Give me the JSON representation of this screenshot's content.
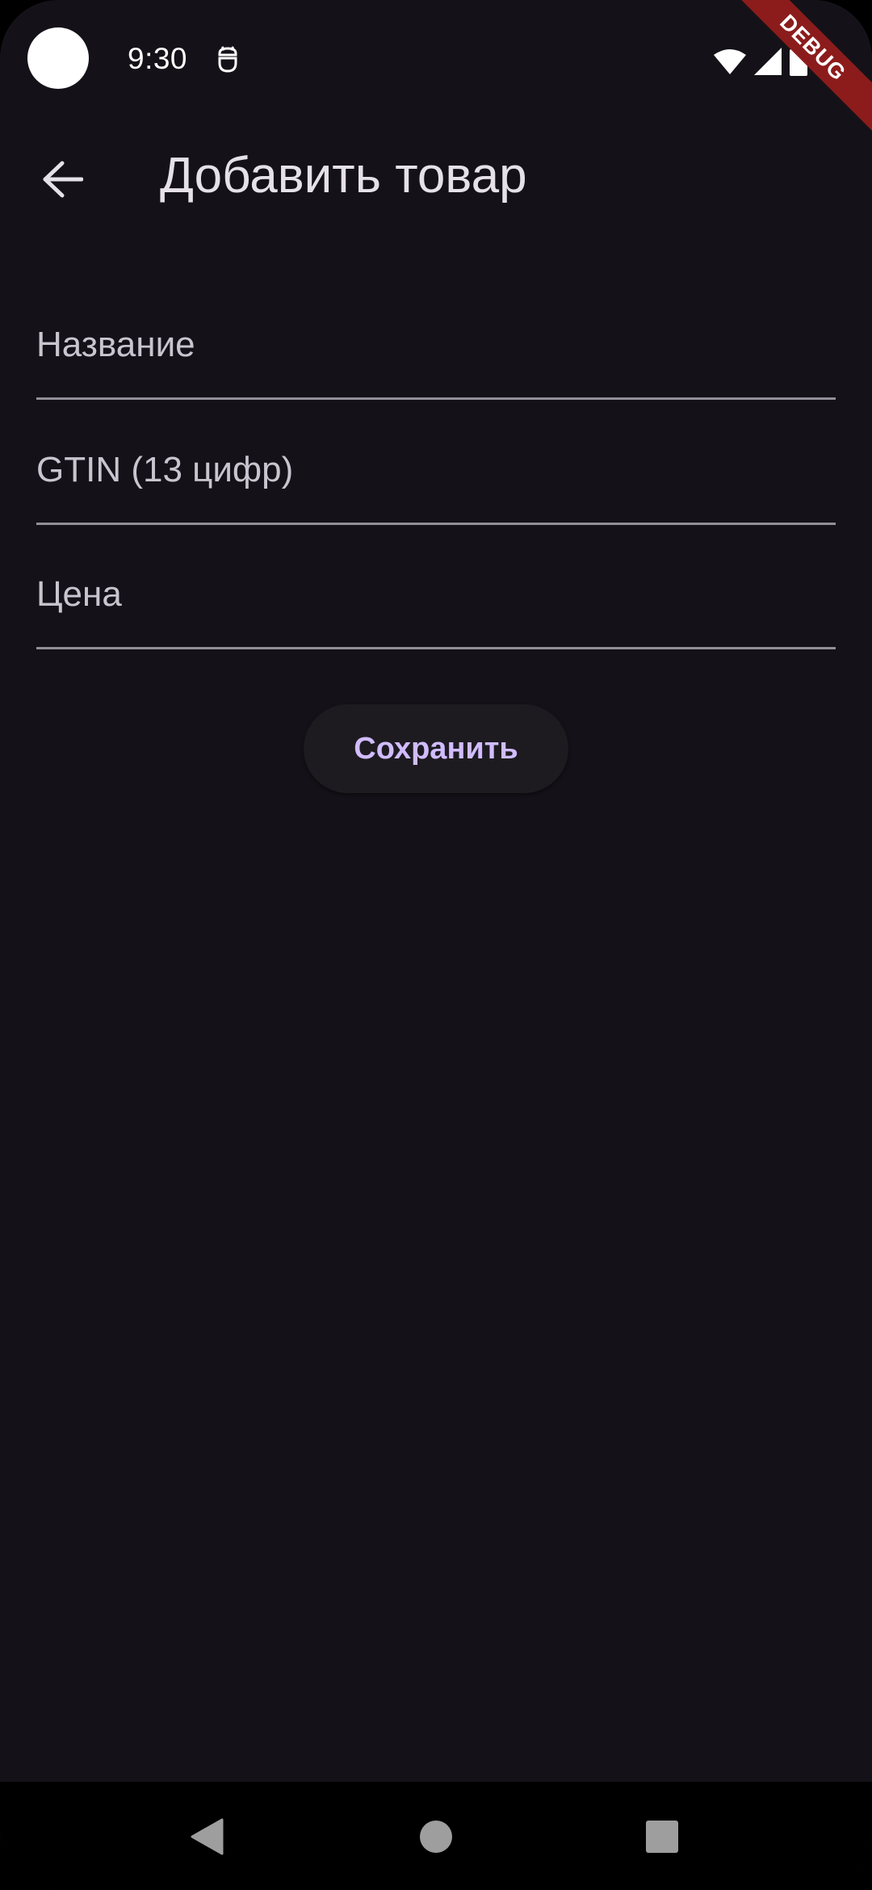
{
  "status_bar": {
    "time": "9:30",
    "icons": [
      "camera-cutout",
      "debug-bug-icon",
      "wifi-icon",
      "signal-icon",
      "battery-icon"
    ]
  },
  "debug_banner": "DEBUG",
  "app_bar": {
    "title": "Добавить товар",
    "back_icon": "arrow-back-icon"
  },
  "form": {
    "name_placeholder": "Название",
    "name_value": "",
    "gtin_placeholder": "GTIN (13 цифр)",
    "gtin_value": "",
    "price_placeholder": "Цена",
    "price_value": ""
  },
  "save_label": "Сохранить",
  "colors": {
    "background": "#141218",
    "accent": "#d0bcff",
    "debug_banner": "#8c1c1c",
    "underline": "#938f99"
  },
  "nav_bar": {
    "icons": [
      "nav-back-icon",
      "nav-home-icon",
      "nav-recents-icon"
    ]
  }
}
